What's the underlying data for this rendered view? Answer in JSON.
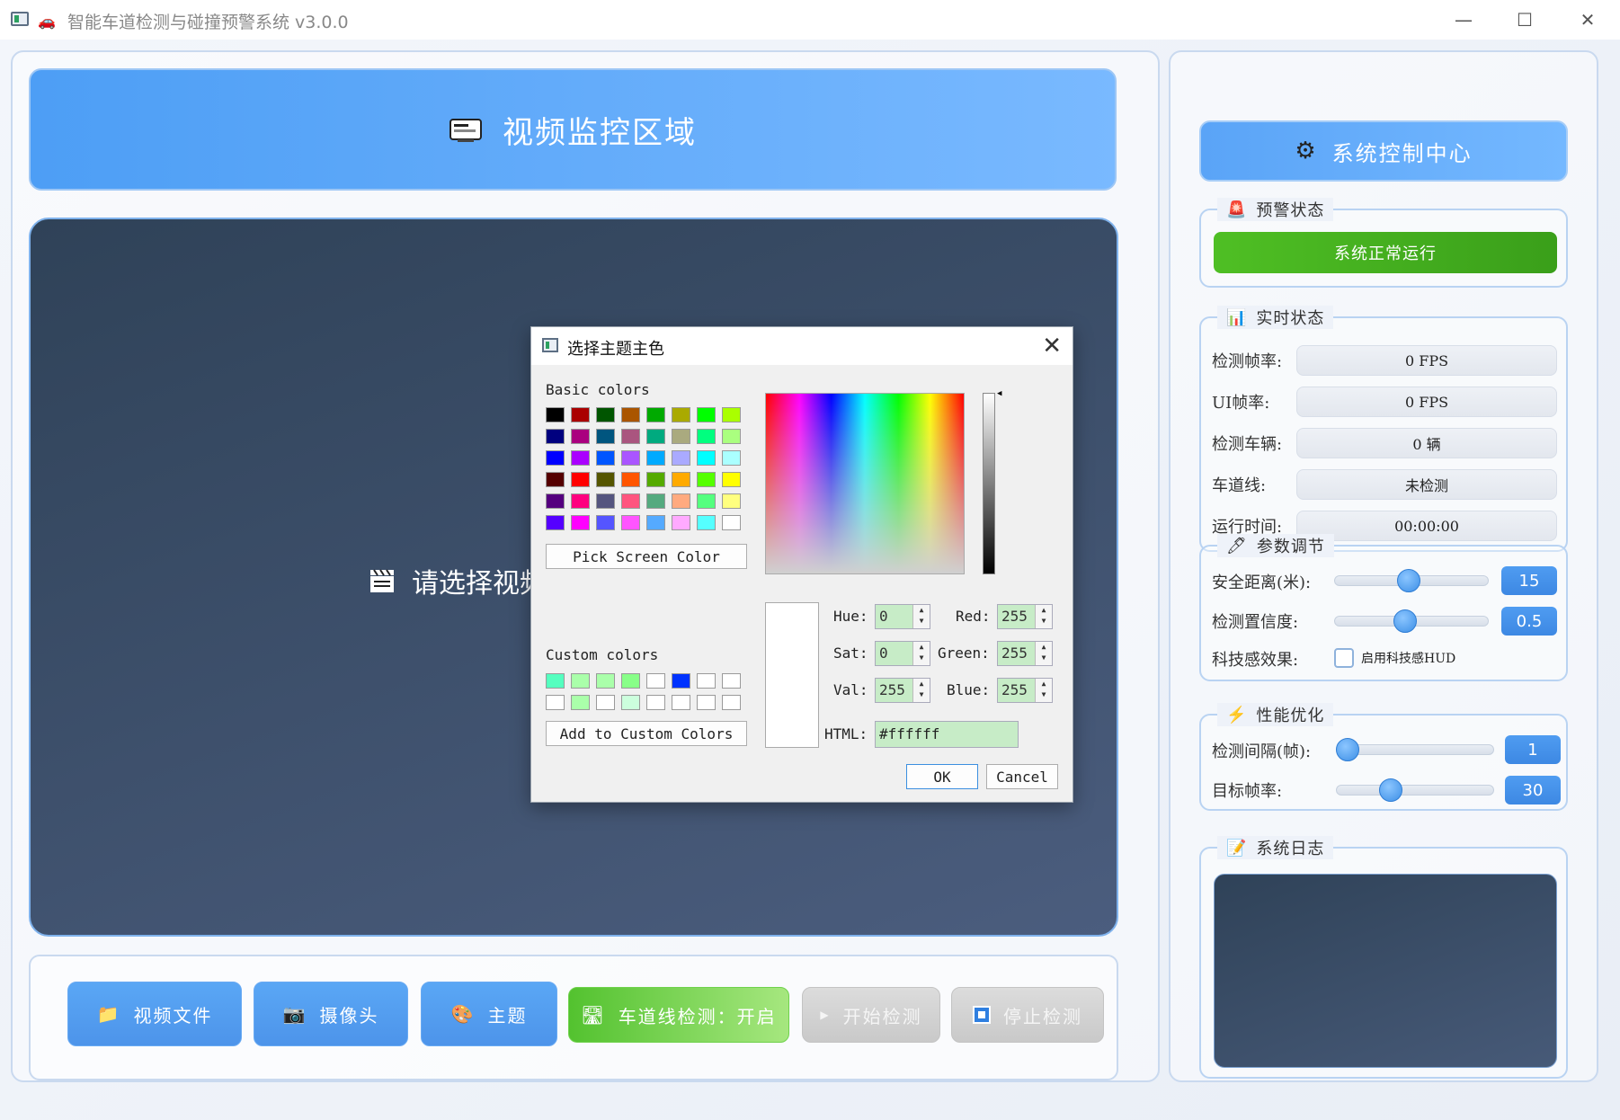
{
  "window": {
    "title": "智能车道检测与碰撞预警系统 v3.0.0",
    "minimize_glyph": "—",
    "maximize_glyph": "☐",
    "close_glyph": "✕"
  },
  "video": {
    "header_title": "视频监控区域",
    "placeholder": "请选择视频"
  },
  "buttons": {
    "video_file": "视频文件",
    "camera": "摄像头",
    "theme": "主题",
    "lane_detect": "车道线检测：开启",
    "start_detect": "开始检测",
    "stop_detect": "停止检测"
  },
  "control": {
    "header_title": "系统控制中心",
    "alert_group": {
      "title": "预警状态",
      "status": "系统正常运行",
      "status_color": "#4fbf24"
    },
    "realtime_group": {
      "title": "实时状态",
      "rows": [
        {
          "label": "检测帧率:",
          "value": "0 FPS"
        },
        {
          "label": "UI帧率:",
          "value": "0 FPS"
        },
        {
          "label": "检测车辆:",
          "value": "0 辆"
        },
        {
          "label": "车道线:",
          "value": "未检测"
        },
        {
          "label": "运行时间:",
          "value": "00:00:00"
        }
      ]
    },
    "params_group": {
      "title": "参数调节",
      "safe_distance_label": "安全距离(米):",
      "safe_distance_value": "15",
      "confidence_label": "检测置信度:",
      "confidence_value": "0.5",
      "tech_label": "科技感效果:",
      "tech_checkbox_label": "启用科技感HUD"
    },
    "perf_group": {
      "title": "性能优化",
      "interval_label": "检测间隔(帧):",
      "interval_value": "1",
      "fps_label": "目标帧率:",
      "fps_value": "30"
    },
    "log_group": {
      "title": "系统日志"
    }
  },
  "dialog": {
    "title": "选择主题主色",
    "basic_colors_label": "Basic colors",
    "pick_screen_label": "Pick Screen Color",
    "custom_colors_label": "Custom colors",
    "add_custom_label": "Add to Custom Colors",
    "hue_label": "Hue:",
    "sat_label": "Sat:",
    "val_label": "Val:",
    "red_label": "Red:",
    "green_label": "Green:",
    "blue_label": "Blue:",
    "hue": "0",
    "sat": "0",
    "val": "255",
    "red": "255",
    "green": "255",
    "blue": "255",
    "html_label": "HTML:",
    "html_value": "#ffffff",
    "ok": "OK",
    "cancel": "Cancel",
    "close_glyph": "✕",
    "basic_colors": [
      "#000000",
      "#aa0000",
      "#005500",
      "#aa5500",
      "#00aa00",
      "#aaaa00",
      "#00ff00",
      "#aaff00",
      "#00007f",
      "#aa007f",
      "#00557f",
      "#aa557f",
      "#00aa7f",
      "#aaaa7f",
      "#00ff7f",
      "#aaff7f",
      "#0000ff",
      "#aa00ff",
      "#0055ff",
      "#aa55ff",
      "#00aaff",
      "#aaaaff",
      "#00ffff",
      "#aaffff",
      "#550000",
      "#ff0000",
      "#555500",
      "#ff5500",
      "#55aa00",
      "#ffaa00",
      "#55ff00",
      "#ffff00",
      "#55007f",
      "#ff007f",
      "#55557f",
      "#ff557f",
      "#55aa7f",
      "#ffaa7f",
      "#55ff7f",
      "#ffff7f",
      "#5500ff",
      "#ff00ff",
      "#5555ff",
      "#ff55ff",
      "#55aaff",
      "#ffaaff",
      "#55ffff",
      "#ffffff"
    ],
    "custom_colors": [
      "#55ffbf",
      "#aaffaa",
      "#aaffaa",
      "#88ff88",
      "#ffffff",
      "#0033ff",
      "#ffffff",
      "#ffffff",
      "#ffffff",
      "#aaffaa",
      "#ffffff",
      "#ccffdd",
      "#ffffff",
      "#ffffff",
      "#ffffff",
      "#ffffff"
    ]
  }
}
